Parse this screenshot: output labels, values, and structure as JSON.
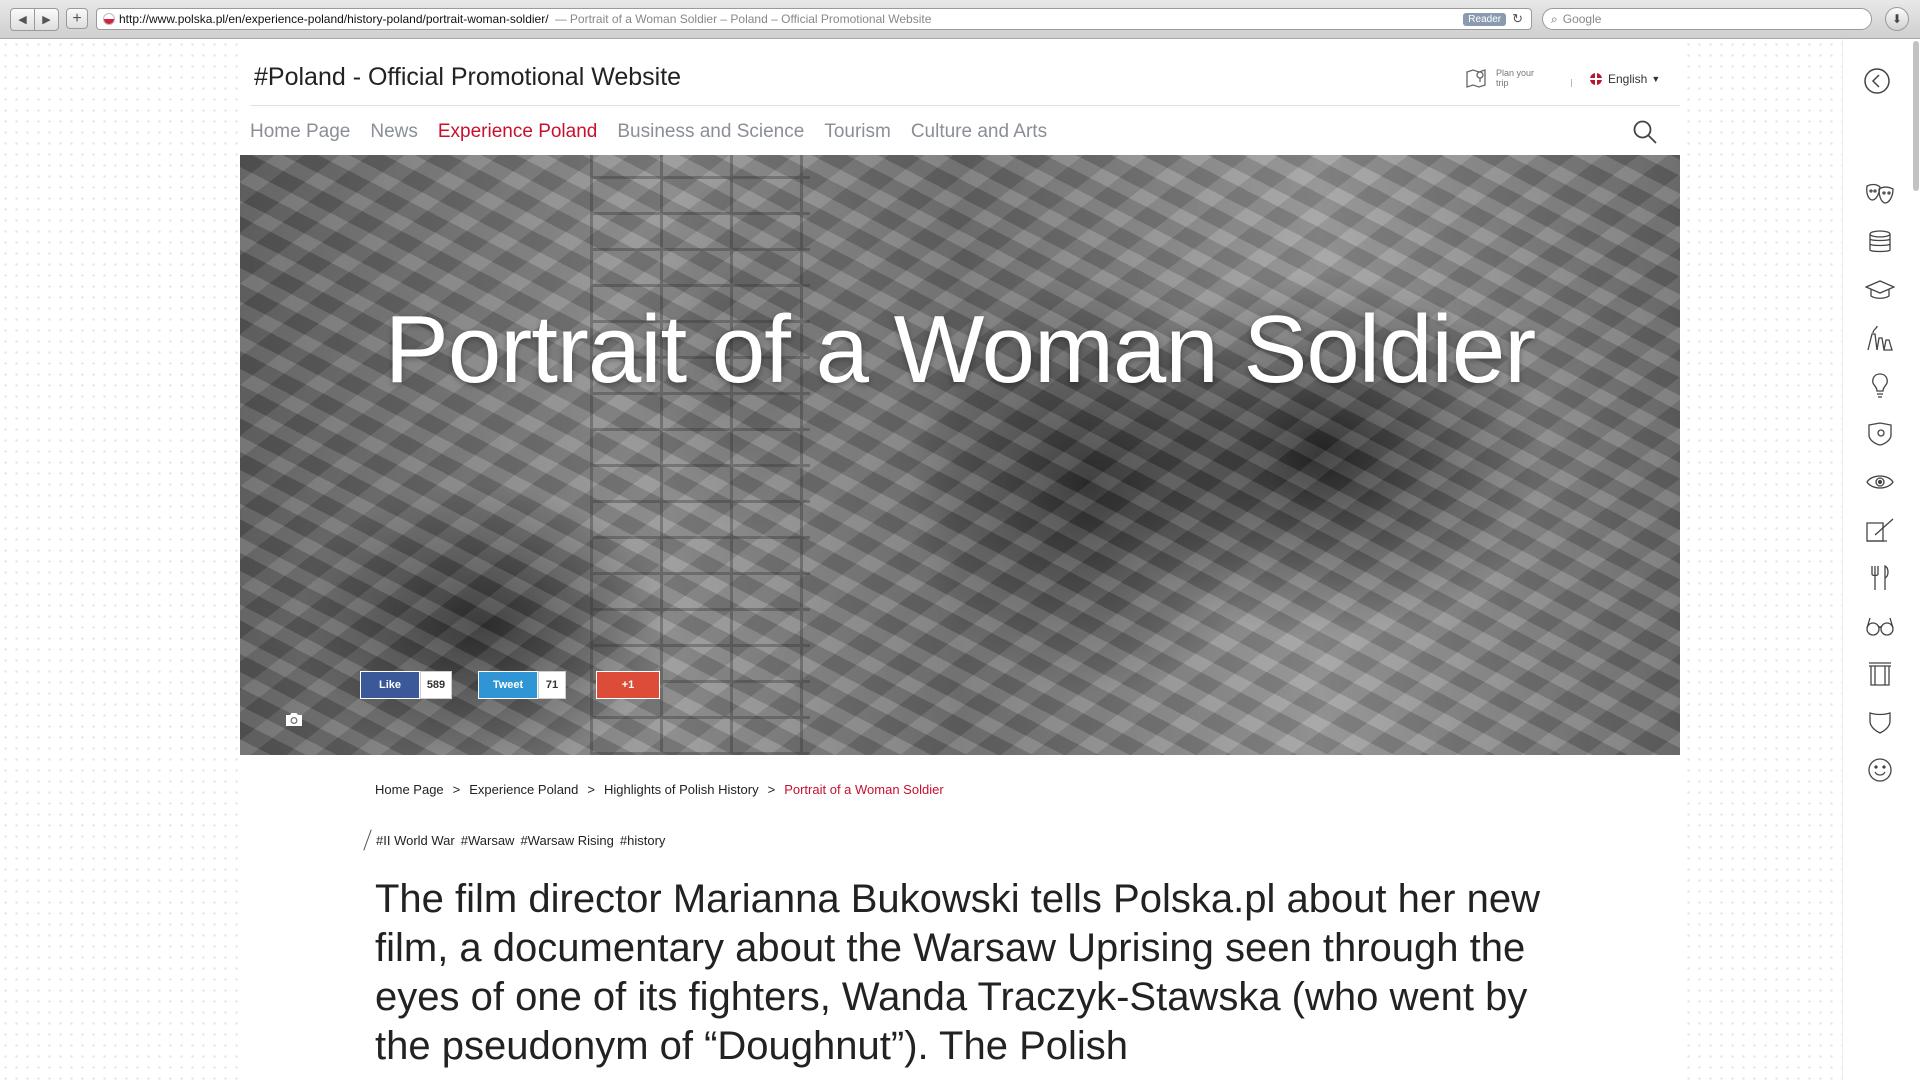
{
  "browser": {
    "url": "http://www.polska.pl/en/experience-poland/history-poland/portrait-woman-soldier/",
    "tab_title": "— Portrait of a Woman Soldier – Poland – Official Promotional Website",
    "reader_label": "Reader",
    "search_placeholder": "Google"
  },
  "header": {
    "site_title": "#Poland - Official Promotional Website",
    "plan_trip": "Plan your trip",
    "language": "English"
  },
  "nav": {
    "items": [
      {
        "label": "Home Page"
      },
      {
        "label": "News"
      },
      {
        "label": "Experience Poland"
      },
      {
        "label": "Business and Science"
      },
      {
        "label": "Tourism"
      },
      {
        "label": "Culture and Arts"
      }
    ],
    "active_index": 2
  },
  "hero": {
    "title": "Portrait of a Woman Soldier"
  },
  "social": {
    "like_label": "Like",
    "like_count": "589",
    "tweet_label": "Tweet",
    "tweet_count": "71",
    "plus_label": "+1"
  },
  "breadcrumb": {
    "items": [
      "Home Page",
      "Experience Poland",
      "Highlights of Polish History",
      "Portrait of a Woman Soldier"
    ],
    "separator": ">"
  },
  "tags": [
    "#II World War",
    "#Warsaw",
    "#Warsaw Rising",
    "#history"
  ],
  "article": {
    "lead": "The film director Marianna Bukowski tells Polska.pl about her new film, a documentary about the Warsaw Uprising seen through the eyes of one of its fighters, Wanda Traczyk-Stawska (who went by the pseudonym of “Doughnut”). The Polish"
  },
  "sidebar_icons": [
    "theatre-masks-icon",
    "coins-icon",
    "graduation-cap-icon",
    "factory-icon",
    "lightbulb-icon",
    "map-shield-icon",
    "eye-icon",
    "notepad-pen-icon",
    "fork-knife-icon",
    "glasses-icon",
    "building-icon",
    "shield-icon",
    "smiley-icon"
  ],
  "colors": {
    "accent": "#c8102e",
    "nav_text": "#8a8f97",
    "facebook": "#3b5998",
    "twitter": "#2f95d4",
    "googleplus": "#dd4b39"
  }
}
